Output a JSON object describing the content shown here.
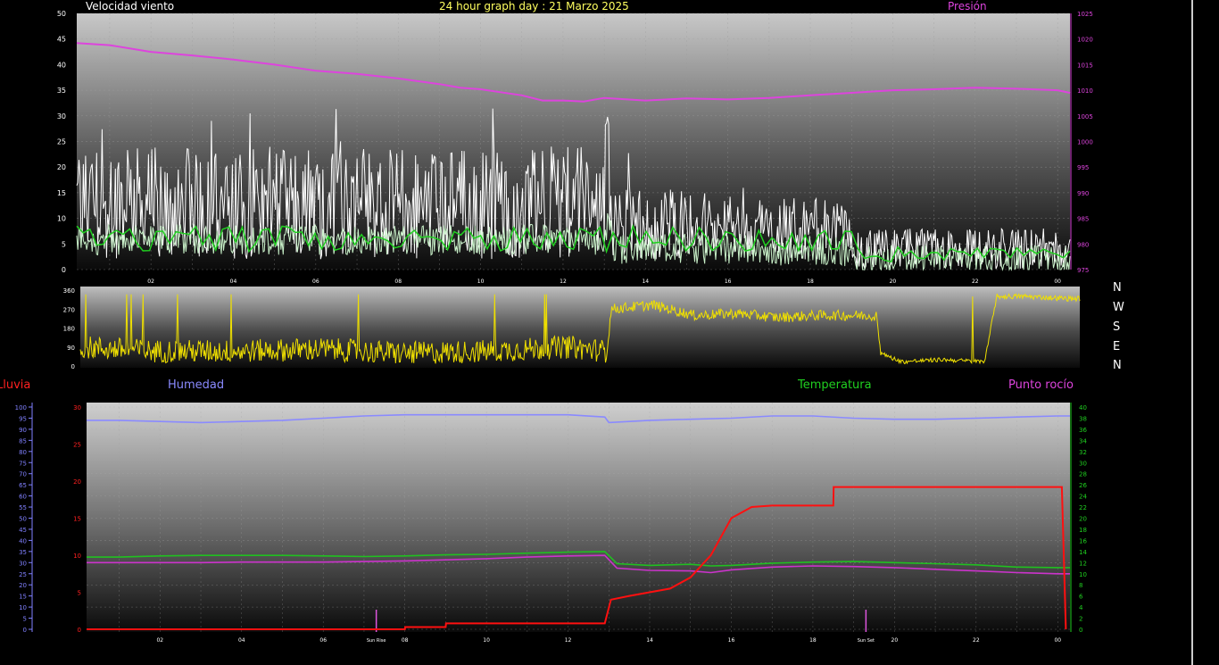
{
  "header": {
    "wind_label": "Velocidad viento",
    "title": "24 hour graph day : 21 Marzo 2025",
    "pressure_label": "Presión"
  },
  "compass": {
    "labels": [
      "N",
      "W",
      "S",
      "E",
      "N"
    ]
  },
  "lower_header": {
    "rain_label": "Lluvia",
    "humidity_label": "Humedad",
    "temperature_label": "Temperatura",
    "dewpoint_label": "Punto rocío"
  },
  "annotations": {
    "sunrise": "Sun Rise",
    "sunset": "Sun Set"
  },
  "colors": {
    "wind_gust": "#ffffff",
    "wind_avg": "#c8f0c8",
    "wind_green": "#20d020",
    "pressure": "#dd44dd",
    "direction": "#f0e000",
    "humidity": "#8a8aff",
    "temperature": "#20c020",
    "dewpoint": "#cc33cc",
    "rain": "#ff1010",
    "axis_left": "#ffffff",
    "axis_right_pressure": "#dd44dd",
    "axis_rain": "#ff2020",
    "axis_humidity": "#8080ff",
    "axis_temp": "#20d020"
  },
  "chart_data": [
    {
      "type": "line",
      "title": "24 hour graph day : 21 Marzo 2025",
      "x_ticks": [
        "02",
        "04",
        "06",
        "08",
        "10",
        "12",
        "14",
        "16",
        "18",
        "20",
        "22",
        "00"
      ],
      "xlim_hours": [
        0.2,
        24.3
      ],
      "y_left": {
        "label": "Velocidad viento",
        "ticks": [
          0,
          5,
          10,
          15,
          20,
          25,
          30,
          35,
          40,
          45,
          50
        ],
        "lim": [
          0,
          50
        ]
      },
      "y_right": {
        "label": "Presión",
        "ticks": [
          975,
          980,
          985,
          990,
          995,
          1000,
          1005,
          1010,
          1015,
          1020,
          1025
        ],
        "lim": [
          975,
          1025
        ]
      },
      "series": [
        {
          "name": "Presión",
          "axis": "right",
          "x": [
            0.2,
            1,
            2,
            3,
            4,
            5,
            6,
            7,
            8,
            9,
            9.5,
            10,
            11,
            11.5,
            12,
            12.5,
            13,
            14,
            15,
            16,
            17,
            18,
            19,
            20,
            21,
            22,
            23,
            24,
            24.3
          ],
          "y": [
            1019.2,
            1018.8,
            1017.5,
            1016.8,
            1016,
            1015,
            1013.8,
            1013.2,
            1012.3,
            1011.2,
            1010.5,
            1010.2,
            1009,
            1008,
            1008,
            1007.8,
            1008.5,
            1008,
            1008.4,
            1008.2,
            1008.5,
            1009,
            1009.5,
            1010,
            1010.2,
            1010.5,
            1010.3,
            1010,
            1009.5
          ]
        }
      ],
      "grid": true
    },
    {
      "type": "line",
      "x_ticks": [],
      "y_left": {
        "ticks": [
          0,
          90,
          180,
          270,
          360
        ],
        "lim": [
          0,
          360
        ]
      },
      "series": [
        {
          "name": "",
          "x": [
            0.2,
            2,
            4,
            6,
            8,
            10,
            12,
            12.9,
            13,
            14,
            15,
            16,
            17,
            18,
            19,
            19.4,
            19.5,
            20,
            21,
            22,
            22.3,
            23,
            24,
            24.3
          ],
          "y": [
            90,
            70,
            70,
            80,
            60,
            70,
            90,
            70,
            270,
            290,
            240,
            250,
            230,
            240,
            240,
            240,
            60,
            20,
            30,
            20,
            330,
            330,
            320,
            320
          ]
        }
      ]
    },
    {
      "type": "line",
      "x_ticks": [
        "02",
        "04",
        "06",
        "08",
        "10",
        "12",
        "14",
        "16",
        "18",
        "20",
        "22",
        "00"
      ],
      "xlim_hours": [
        0.2,
        24.3
      ],
      "y_rain": {
        "label": "Lluvia",
        "ticks": [
          0,
          5,
          10,
          15,
          20,
          25,
          30
        ],
        "lim": [
          0,
          30
        ]
      },
      "y_humidity": {
        "label": "Humedad",
        "ticks": [
          0,
          5,
          10,
          15,
          20,
          25,
          30,
          35,
          40,
          45,
          50,
          55,
          60,
          65,
          70,
          75,
          80,
          85,
          90,
          95,
          100
        ],
        "lim": [
          0,
          100
        ]
      },
      "y_temp": {
        "label": "Temperatura",
        "ticks": [
          0,
          2,
          4,
          6,
          8,
          10,
          12,
          14,
          16,
          18,
          20,
          22,
          24,
          26,
          28,
          30,
          32,
          34,
          36,
          38,
          40
        ],
        "lim": [
          0,
          40
        ]
      },
      "series": [
        {
          "name": "Humedad",
          "axis": "humidity",
          "x": [
            0.2,
            1,
            2,
            3,
            4,
            5,
            6,
            7,
            8,
            9,
            10,
            11,
            12,
            12.9,
            13,
            14,
            15,
            16,
            17,
            18,
            19,
            20,
            21,
            22,
            23,
            24,
            24.3
          ],
          "y": [
            94,
            94,
            93.5,
            93,
            93.5,
            94,
            95,
            96,
            96.5,
            96.5,
            96.5,
            96.5,
            96.5,
            95.5,
            93,
            94,
            94.5,
            95,
            96,
            96,
            95,
            94.5,
            94.5,
            95,
            95.5,
            96,
            96
          ]
        },
        {
          "name": "Temperatura",
          "axis": "temp",
          "x": [
            0.2,
            1,
            2,
            3,
            4,
            5,
            6,
            7,
            8,
            9,
            10,
            11,
            12,
            12.9,
            13.2,
            14,
            15,
            15.5,
            16,
            17,
            18,
            19,
            20,
            21,
            22,
            23,
            24,
            24.3
          ],
          "y": [
            13,
            13,
            13.2,
            13.3,
            13.3,
            13.3,
            13.2,
            13.1,
            13.2,
            13.4,
            13.5,
            13.7,
            13.9,
            14,
            11.8,
            11.5,
            11.7,
            11.4,
            11.5,
            11.9,
            12.1,
            12.2,
            12.0,
            11.8,
            11.6,
            11.2,
            11.1,
            11.1
          ]
        },
        {
          "name": "Punto rocío",
          "axis": "temp",
          "x": [
            0.2,
            1,
            2,
            3,
            4,
            5,
            6,
            7,
            8,
            9,
            10,
            11,
            12,
            12.9,
            13.2,
            14,
            15,
            15.5,
            16,
            17,
            18,
            19,
            20,
            21,
            22,
            23,
            24,
            24.3
          ],
          "y": [
            12,
            12,
            12,
            12,
            12.1,
            12.1,
            12.1,
            12.2,
            12.3,
            12.5,
            12.7,
            13,
            13.2,
            13.3,
            11,
            10.6,
            10.5,
            10.2,
            10.7,
            11.2,
            11.4,
            11.3,
            11.1,
            10.8,
            10.5,
            10.2,
            10,
            10
          ]
        },
        {
          "name": "Lluvia",
          "axis": "rain",
          "x": [
            0.2,
            7,
            8,
            8.01,
            9,
            9.01,
            12,
            12.9,
            13.05,
            13.5,
            14,
            14.5,
            15,
            15.5,
            16,
            16.5,
            17,
            18.5,
            18.51,
            20,
            22,
            24,
            24.1,
            24.2
          ],
          "y": [
            0,
            0,
            0,
            0.3,
            0.3,
            0.8,
            0.8,
            0.8,
            4,
            4.5,
            5,
            5.5,
            7,
            10,
            15,
            16.5,
            16.7,
            16.7,
            19.2,
            19.2,
            19.2,
            19.2,
            19.2,
            0
          ]
        }
      ],
      "grid": true
    }
  ]
}
